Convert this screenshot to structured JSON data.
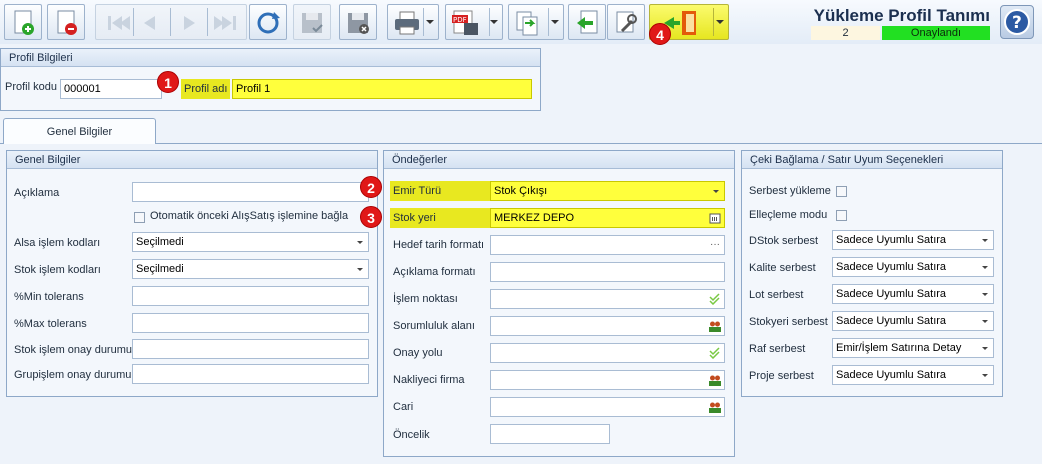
{
  "window": {
    "title": "Yükleme Profil Tanımı",
    "record_no": "2",
    "status": "Onaylandı",
    "colors": {
      "status": "#22e022",
      "highlight": "#ffff3c",
      "badge": "#e01818"
    }
  },
  "toolbar": {
    "buttons": [
      {
        "name": "new-record-icon",
        "enabled": true
      },
      {
        "name": "delete-record-icon",
        "enabled": true
      },
      {
        "name": "first-record-icon",
        "enabled": false
      },
      {
        "name": "prev-record-icon",
        "enabled": false
      },
      {
        "name": "next-record-icon",
        "enabled": false
      },
      {
        "name": "last-record-icon",
        "enabled": false
      },
      {
        "name": "refresh-icon",
        "enabled": true
      },
      {
        "name": "save-icon",
        "enabled": false
      },
      {
        "name": "cancel-save-icon",
        "enabled": false
      },
      {
        "name": "print-icon",
        "enabled": true
      },
      {
        "name": "pdf-export-icon",
        "enabled": true
      },
      {
        "name": "copy-icon",
        "enabled": true
      },
      {
        "name": "back-icon",
        "enabled": true
      },
      {
        "name": "tools-icon",
        "enabled": true
      },
      {
        "name": "exit-icon",
        "enabled": true
      }
    ]
  },
  "profil": {
    "section_title": "Profil Bilgileri",
    "kod_label": "Profil kodu",
    "kod_value": "000001",
    "ad_label": "Profil adı",
    "ad_value": "Profil 1"
  },
  "tabs": [
    "Genel Bilgiler"
  ],
  "genel": {
    "title": "Genel Bilgiler",
    "aciklama_label": "Açıklama",
    "aciklama_value": "",
    "oto_label": "Otomatik önceki AlışSatış işlemine bağla",
    "alsa_label": "Alsa işlem kodları",
    "alsa_value": "Seçilmedi",
    "stok_label": "Stok işlem kodları",
    "stok_value": "Seçilmedi",
    "min_label": "%Min tolerans",
    "max_label": "%Max tolerans",
    "stok_onay_label": "Stok işlem onay durumu",
    "grup_onay_label": "Grupişlem onay durumu"
  },
  "onde": {
    "title": "Öndeğerler",
    "emir_label": "Emir Türü",
    "emir_value": "Stok Çıkışı",
    "stokyeri_label": "Stok yeri",
    "stokyeri_value": "MERKEZ DEPO",
    "hedef_label": "Hedef tarih formatı",
    "aciklama_label": "Açıklama formatı",
    "islem_label": "İşlem noktası",
    "sorum_label": "Sorumluluk alanı",
    "onay_label": "Onay yolu",
    "nakliye_label": "Nakliyeci firma",
    "cari_label": "Cari",
    "oncelik_label": "Öncelik"
  },
  "ceki": {
    "title": "Çeki Bağlama / Satır Uyum Seçenekleri",
    "serbest_label": "Serbest yükleme",
    "elleme_label": "Elleçleme modu",
    "dstok_label": "DStok serbest",
    "dstok_value": "Sadece Uyumlu Satıra",
    "kalite_label": "Kalite serbest",
    "kalite_value": "Sadece Uyumlu Satıra",
    "lot_label": "Lot serbest",
    "lot_value": "Sadece Uyumlu Satıra",
    "stokyeri_label": "Stokyeri serbest",
    "stokyeri_value": "Sadece Uyumlu Satıra",
    "raf_label": "Raf serbest",
    "raf_value": "Emir/İşlem Satırına Detay",
    "proje_label": "Proje serbest",
    "proje_value": "Sadece Uyumlu Satıra"
  },
  "badges": [
    "1",
    "2",
    "3",
    "4"
  ]
}
